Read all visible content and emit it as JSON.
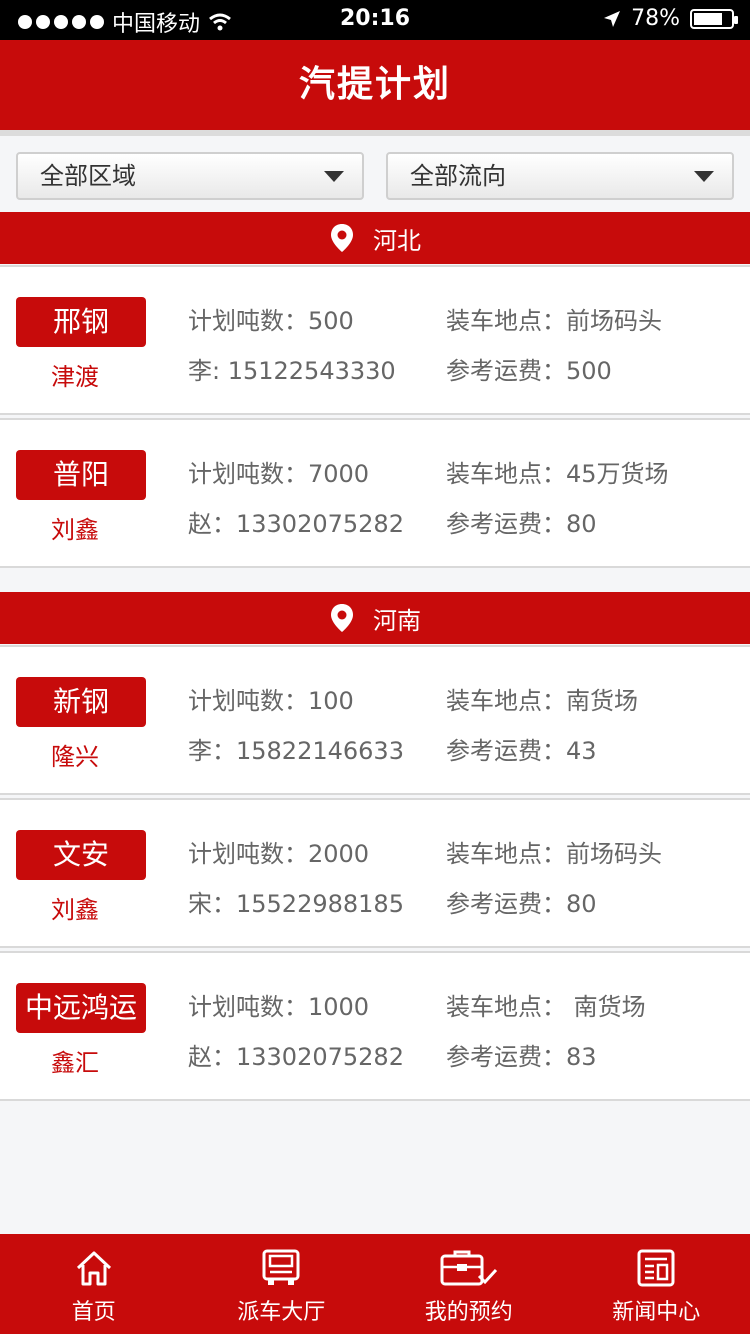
{
  "status_bar": {
    "carrier": "中国移动",
    "time": "20:16",
    "battery": "78%",
    "battery_level": 0.78
  },
  "header": {
    "title": "汽提计划"
  },
  "filters": {
    "region": "全部区域",
    "direction": "全部流向"
  },
  "sections": [
    {
      "region": "河北",
      "cards": [
        {
          "name": "邢钢",
          "sub": "津渡",
          "plan": "计划吨数：500",
          "contact": "李: 15122543330",
          "location": "装车地点：前场码头",
          "fee": "参考运费：500"
        },
        {
          "name": "普阳",
          "sub": "刘鑫",
          "plan": "计划吨数：7000",
          "contact": "赵：13302075282",
          "location": "装车地点：45万货场",
          "fee": "参考运费：80"
        }
      ]
    },
    {
      "region": "河南",
      "cards": [
        {
          "name": "新钢",
          "sub": "隆兴",
          "plan": "计划吨数：100",
          "contact": "李：15822146633",
          "location": "装车地点：南货场",
          "fee": "参考运费：43"
        },
        {
          "name": "文安",
          "sub": "刘鑫",
          "plan": "计划吨数：2000",
          "contact": "宋：15522988185",
          "location": "装车地点：前场码头",
          "fee": "参考运费：80"
        },
        {
          "name": "中远鸿运",
          "sub": "鑫汇",
          "plan": "计划吨数：1000",
          "contact": "赵：13302075282",
          "location": "装车地点： 南货场",
          "fee": "参考运费：83"
        }
      ]
    }
  ],
  "tabs": [
    {
      "label": "首页",
      "icon": "home-icon"
    },
    {
      "label": "派车大厅",
      "icon": "truck-icon"
    },
    {
      "label": "我的预约",
      "icon": "briefcase-check-icon"
    },
    {
      "label": "新闻中心",
      "icon": "newspaper-icon"
    }
  ],
  "colors": {
    "brand_red": "#c70b0b",
    "text_gray": "#666666"
  }
}
